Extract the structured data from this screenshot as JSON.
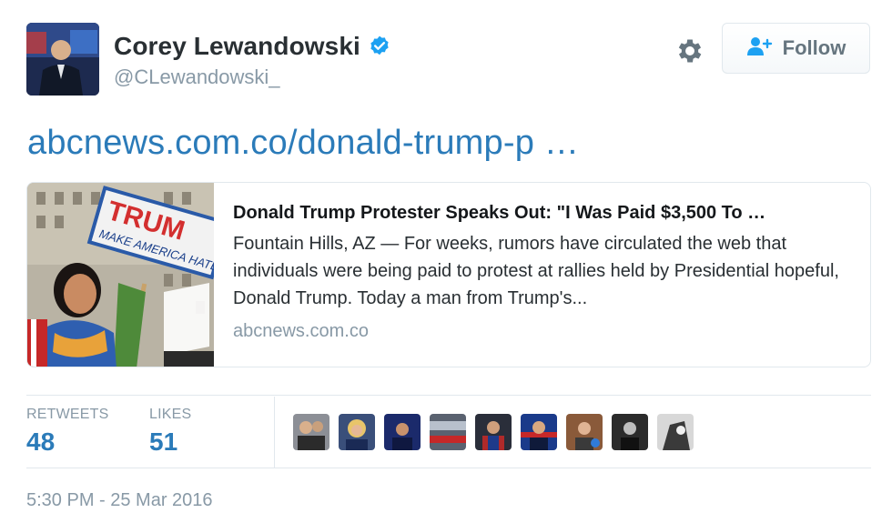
{
  "author": {
    "name": "Corey Lewandowski",
    "handle": "@CLewandowski_",
    "verified": true,
    "avatar_icon": "profile-photo"
  },
  "actions": {
    "settings_icon": "gear-icon",
    "follow_icon": "add-user-icon",
    "follow_label": "Follow"
  },
  "tweet": {
    "link_text": "abcnews.com.co/donald-trump-p …"
  },
  "card": {
    "image_icon": "protest-photo",
    "title": "Donald Trump Protester Speaks Out: \"I Was Paid $3,500 To …",
    "description": "Fountain Hills, AZ — For weeks, rumors have circulated the web that individuals were being paid to protest at rallies held by Presidential hopeful, Donald Trump. Today a man from Trump's...",
    "domain": "abcnews.com.co"
  },
  "stats": {
    "retweets_label": "RETWEETS",
    "retweets_value": "48",
    "likes_label": "LIKES",
    "likes_value": "51"
  },
  "timestamp": "5:30 PM - 25 Mar 2016",
  "colors": {
    "link": "#2b7bb9",
    "muted": "#8899a6",
    "verified": "#1da1f2",
    "border": "#e1e8ed"
  }
}
